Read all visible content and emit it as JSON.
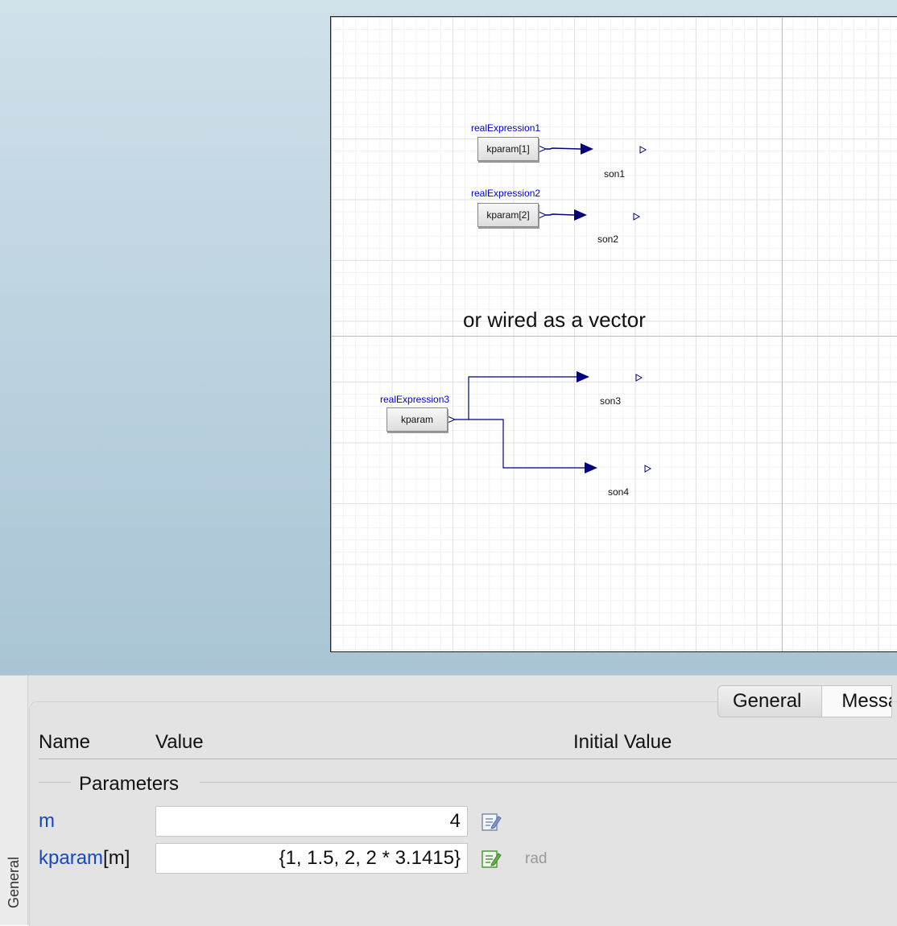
{
  "diagram": {
    "note": "or wired as a vector",
    "blocks": [
      {
        "name_label": "realExpression1",
        "text": "kparam[1]"
      },
      {
        "name_label": "realExpression2",
        "text": "kparam[2]"
      },
      {
        "name_label": "realExpression3",
        "text": "kparam"
      }
    ],
    "sons": [
      "son1",
      "son2",
      "son3",
      "son4"
    ],
    "colors": {
      "wire": "#00007f",
      "component_label": "#0000dd"
    }
  },
  "panel": {
    "side_tab": "General",
    "tabs": [
      "General",
      "Messages"
    ],
    "columns": {
      "name": "Name",
      "value": "Value",
      "initial": "Initial Value"
    },
    "group": "Parameters",
    "params": [
      {
        "name": "m",
        "suffix": "",
        "value": "4",
        "unit": ""
      },
      {
        "name": "kparam",
        "suffix": "[m]",
        "value": "{1, 1.5, 2, 2 * 3.1415}",
        "unit": "rad"
      }
    ]
  }
}
